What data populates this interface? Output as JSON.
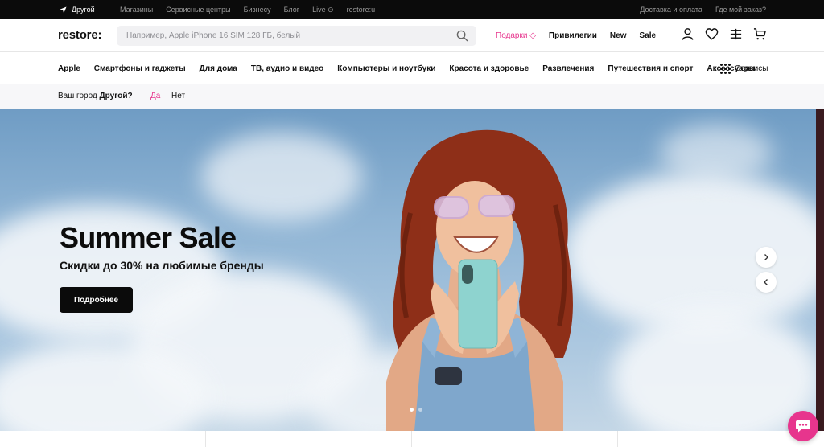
{
  "topbar": {
    "city": "Другой",
    "links": [
      "Магазины",
      "Сервисные центры",
      "Бизнесу",
      "Блог",
      "Live ⊙",
      "restore:u"
    ],
    "right": [
      "Доставка и оплата",
      "Где мой заказ?"
    ]
  },
  "header": {
    "logo": "restore:",
    "search_placeholder": "Например, Apple iPhone 16 SIM 128 ГБ, белый",
    "nav": {
      "gifts": "Подарки ◇",
      "privileges": "Привилегии",
      "new": "New",
      "sale": "Sale"
    },
    "icons": [
      "user-icon",
      "heart-icon",
      "compare-icon",
      "cart-icon"
    ]
  },
  "categories": [
    "Apple",
    "Смартфоны и гаджеты",
    "Для дома",
    "ТВ, аудио и видео",
    "Компьютеры и ноутбуки",
    "Красота и здоровье",
    "Развлечения",
    "Путешествия и спорт",
    "Аксессуары"
  ],
  "services_label": "Сервисы",
  "citybar": {
    "question": "Ваш город",
    "city": "Другой?",
    "yes": "Да",
    "no": "Нет"
  },
  "hero": {
    "title": "Summer Sale",
    "subtitle": "Скидки до 30% на любимые бренды",
    "button": "Подробнее"
  },
  "colors": {
    "accent": "#e7358d",
    "dark": "#0b0b0b"
  }
}
